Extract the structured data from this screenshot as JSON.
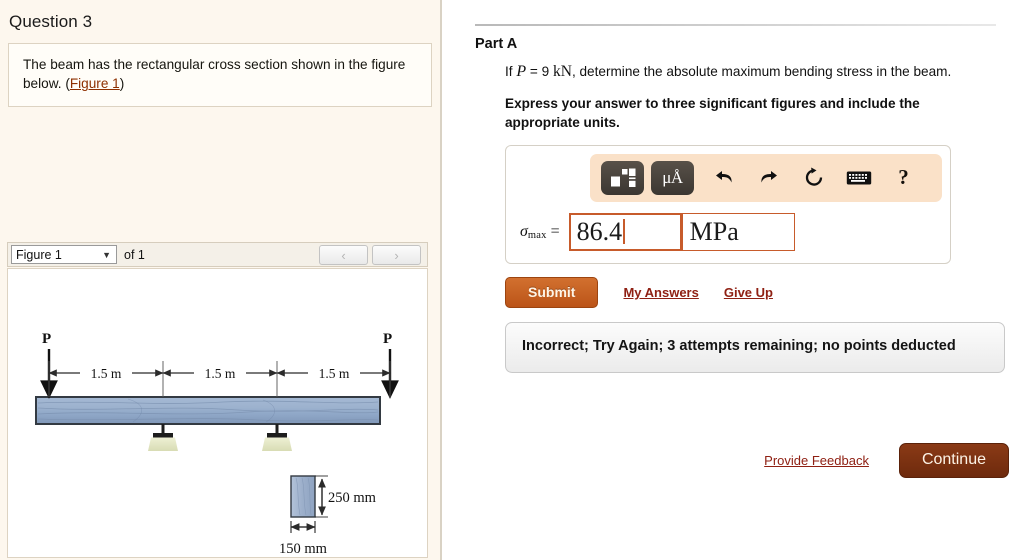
{
  "left": {
    "question_title": "Question 3",
    "statement_pre": "The beam has the rectangular cross section shown in the figure below. (",
    "statement_link": "Figure 1",
    "statement_post": ")",
    "figure_selector": {
      "selected": "Figure 1",
      "of_label": "of 1",
      "prev_icon": "‹",
      "next_icon": "›"
    }
  },
  "figure": {
    "load_left_label": "P",
    "load_right_label": "P",
    "span_1": "1.5 m",
    "span_2": "1.5 m",
    "span_3": "1.5 m",
    "section_height_label": "250 mm",
    "section_width_label": "150 mm",
    "beam_color": "#8ea7c6",
    "beam_edge_color": "#33383f",
    "support_pad_color": "#e3e8c8"
  },
  "right": {
    "part_title": "Part A",
    "prompt": {
      "if_word": "If",
      "var_P": "P",
      "equals": "=",
      "value_P": "9",
      "unit_P": "kN",
      "rest": ", determine the absolute maximum bending stress in the beam."
    },
    "instruction": "Express your answer to three significant figures and include the appropriate units.",
    "toolbar": {
      "template_icon": "template-icon",
      "units_icon_label": "μÅ",
      "undo_icon": "↶",
      "redo_icon": "↷",
      "reset_icon": "⟳",
      "keyboard_icon": "⌨",
      "help_icon": "?"
    },
    "answer": {
      "sigma_symbol": "σ",
      "sigma_subscript": "max",
      "equals": "=",
      "value": "86.4",
      "unit": "MPa"
    },
    "submit_label": "Submit",
    "my_answers_label": "My Answers",
    "give_up_label": "Give Up",
    "feedback": "Incorrect; Try Again; 3 attempts remaining; no points deducted",
    "provide_feedback_label": "Provide Feedback",
    "continue_label": "Continue"
  },
  "colors": {
    "accent_orange": "#c75b2b",
    "submit_orange": "#bb5418",
    "link_red": "#8f2013",
    "continue_brown": "#6e2a0d",
    "panel_cream": "#fdf7ee"
  }
}
